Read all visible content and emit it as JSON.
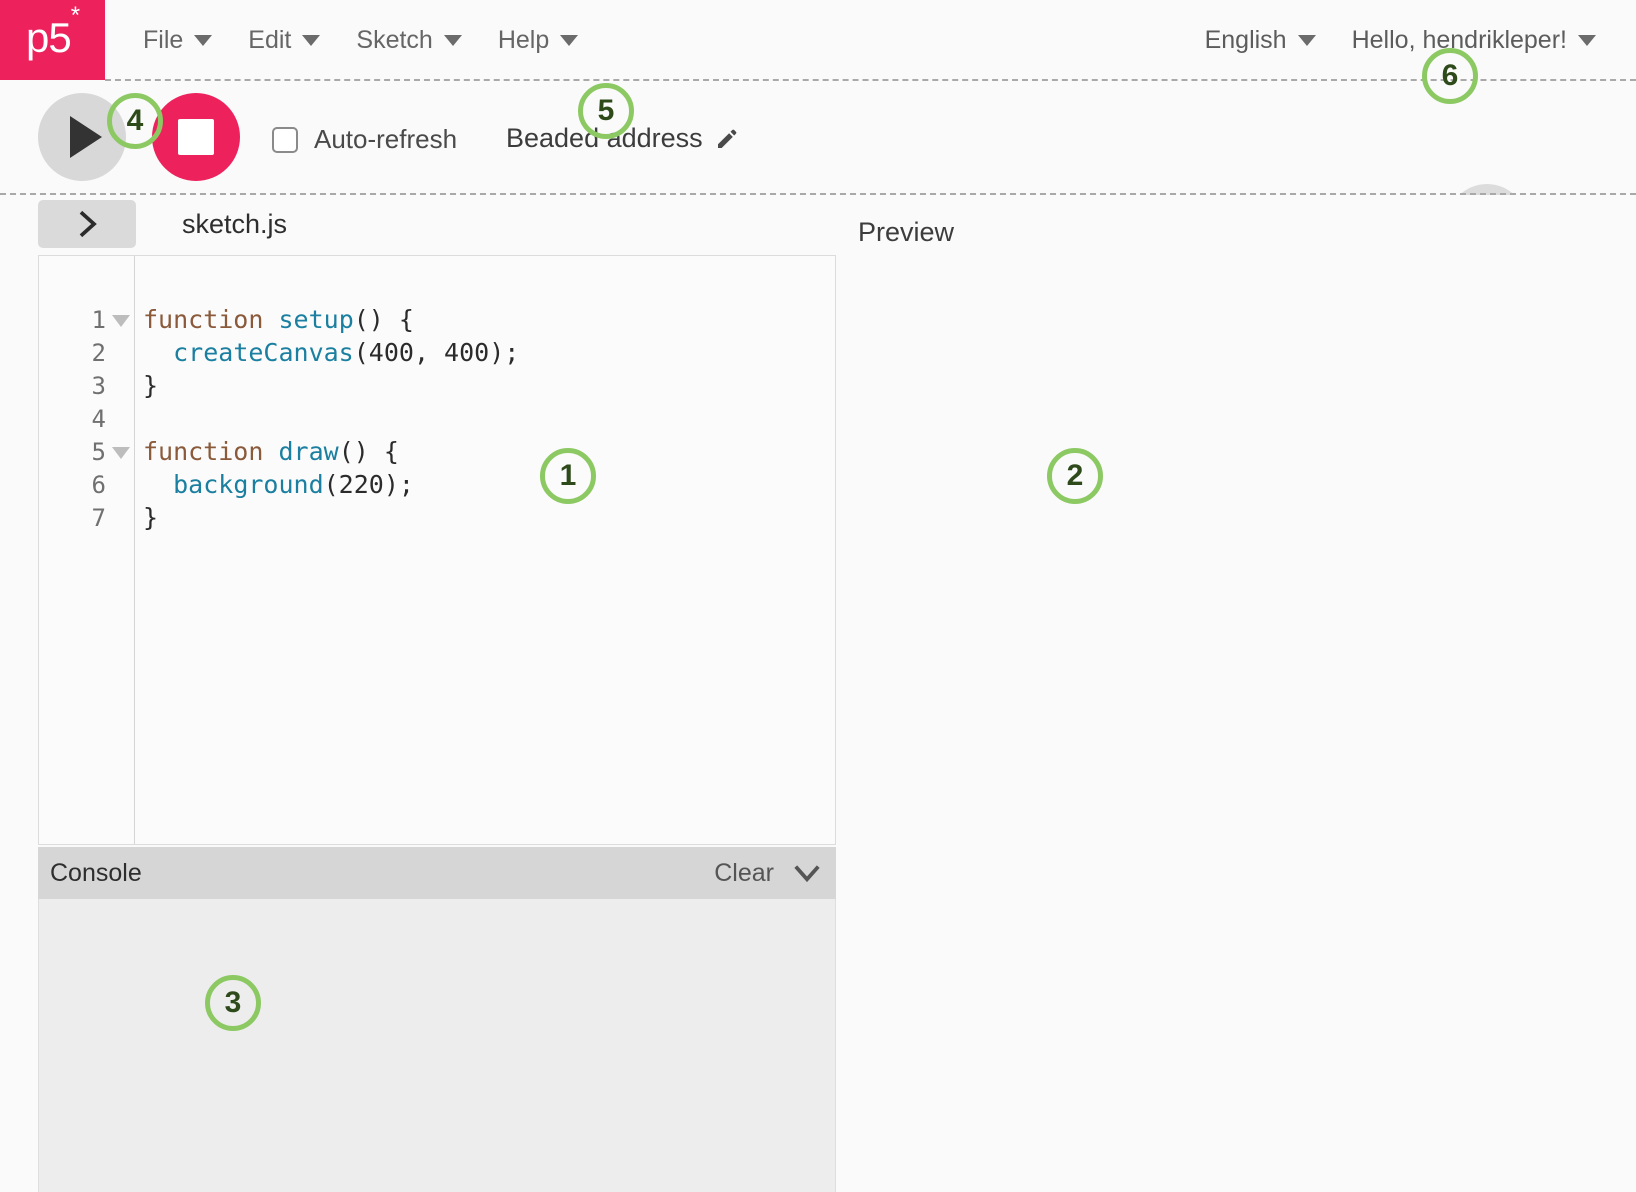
{
  "app": {
    "logo": "p5",
    "logo_superscript": "*"
  },
  "topnav": {
    "menus": [
      {
        "label": "File",
        "icon": "chevron-down-icon"
      },
      {
        "label": "Edit",
        "icon": "chevron-down-icon"
      },
      {
        "label": "Sketch",
        "icon": "chevron-down-icon"
      },
      {
        "label": "Help",
        "icon": "chevron-down-icon"
      }
    ],
    "language": "English",
    "account": "Hello, hendrikleper!"
  },
  "toolbar": {
    "play_icon": "play-icon",
    "stop_icon": "stop-icon",
    "autorefresh_label": "Auto-refresh",
    "autorefresh_checked": false,
    "sketch_name": "Beaded address",
    "edit_icon": "pencil-icon",
    "settings_icon": "gear-icon"
  },
  "editor": {
    "sidebar_toggle_icon": "chevron-right-icon",
    "filename": "sketch.js",
    "line_numbers": [
      "1",
      "2",
      "3",
      "4",
      "5",
      "6",
      "7"
    ],
    "fold_lines": [
      1,
      5
    ],
    "code_lines": [
      "function setup() {",
      "  createCanvas(400, 400);",
      "}",
      "",
      "function draw() {",
      "  background(220);",
      "}"
    ]
  },
  "console": {
    "title": "Console",
    "clear_label": "Clear",
    "collapse_icon": "chevron-down-icon",
    "messages": []
  },
  "preview": {
    "label": "Preview"
  },
  "annotations": [
    {
      "id": "1",
      "target": "code-editor"
    },
    {
      "id": "2",
      "target": "preview-panel"
    },
    {
      "id": "3",
      "target": "console-panel"
    },
    {
      "id": "4",
      "target": "play-stop-controls"
    },
    {
      "id": "5",
      "target": "sketch-name"
    },
    {
      "id": "6",
      "target": "account-menu"
    }
  ],
  "colors": {
    "brand_pink": "#ed225d",
    "annotation_ring": "#8cc963",
    "annotation_text": "#2e4a1a",
    "code_keyword": "#8a5a3b",
    "code_function": "#1a7fa0",
    "console_header": "#d6d6d6"
  }
}
